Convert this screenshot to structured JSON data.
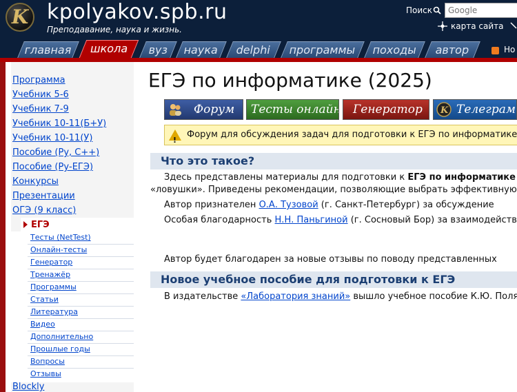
{
  "header": {
    "logo_letter": "K",
    "site_title": "kpolyakov.spb.ru",
    "subtitle": "Преподавание, наука и жизнь.",
    "search_label": "Поиск",
    "search_placeholder": "Google",
    "sitemap_label": "карта сайта",
    "rss_text": "Но"
  },
  "tabs": [
    {
      "label": "главная",
      "active": false
    },
    {
      "label": "школа",
      "active": true
    },
    {
      "label": "вуз",
      "active": false
    },
    {
      "label": "наука",
      "active": false
    },
    {
      "label": "delphi",
      "active": false
    },
    {
      "label": "программы",
      "active": false
    },
    {
      "label": "походы",
      "active": false
    },
    {
      "label": "автор",
      "active": false
    }
  ],
  "sidebar": {
    "items": [
      "Программа",
      "Учебник 5-6",
      "Учебник 7-9",
      "Учебник 10-11(Б+У)",
      "Учебник 10-11(У)",
      "Пособие (Ру, С++)",
      "Пособие (Ру-ЕГЭ)",
      "Конкурсы",
      "Презентации",
      "ОГЭ (9 класс)"
    ],
    "active": "ЕГЭ",
    "subitems": [
      "Тесты (NetTest)",
      "Онлайн-тесты",
      "Генератор",
      "Тренажёр",
      "Программы",
      "Статьи",
      "Литература",
      "Видео",
      "Дополнительно",
      "Прошлые годы",
      "Вопросы",
      "Отзывы"
    ],
    "after": "Blockly"
  },
  "main": {
    "title": "ЕГЭ по информатике (2025)",
    "buttons": [
      "Форум",
      "Тесты онлайн",
      "Генератор",
      "Телеграм"
    ],
    "alert": "Форум для обсуждения задач для подготовки к ЕГЭ по информатике",
    "section1_title": "Что это такое?",
    "p1_a": "Здесь представлены материалы для подготовки к ",
    "p1_b": "ЕГЭ по информатике",
    "p1_line2": "«ловушки». Приведены рекомендации, позволяющие выбрать эффективную",
    "p2_a": "Автор признателен ",
    "p2_link": "О.А. Тузовой",
    "p2_b": " (г. Санкт-Петербург) за обсуждение",
    "p3_a": "Особая благодарность ",
    "p3_link": "Н.Н. Паньгиной",
    "p3_b": " (г. Сосновый Бор) за взаимодействие",
    "p4": "Автор будет благодарен за новые отзывы по поводу представленных",
    "section2_title": "Новое учебное пособие для подготовки к ЕГЭ",
    "p5_a": "В издательстве ",
    "p5_link": "«Лаборатория знаний»",
    "p5_b": " вышло учебное пособие К.Ю. Полякова"
  },
  "colors": {
    "header_bg": "#0c1f3a",
    "accent_red": "#b00000",
    "link_blue": "#0044cc",
    "section_bar": "#dfe6ef"
  }
}
